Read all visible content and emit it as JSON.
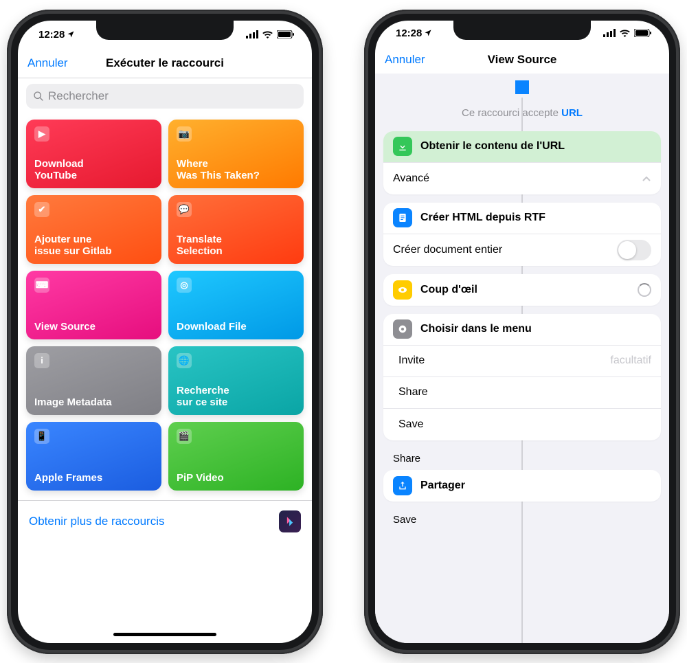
{
  "statusbar": {
    "time": "12:28"
  },
  "left": {
    "cancel": "Annuler",
    "title": "Exécuter le raccourci",
    "search_placeholder": "Rechercher",
    "tiles": [
      {
        "label": "Download\nYouTube",
        "icon": "▶",
        "gradient": "linear-gradient(160deg,#ff3b57,#e6192f)"
      },
      {
        "label": "Where\nWas This Taken?",
        "icon": "📷",
        "gradient": "linear-gradient(160deg,#ffb02e,#ff7a00)"
      },
      {
        "label": "Ajouter une\nissue sur Gitlab",
        "icon": "✔",
        "gradient": "linear-gradient(160deg,#ff7a3d,#ff4f12)"
      },
      {
        "label": "Translate\nSelection",
        "icon": "💬",
        "gradient": "linear-gradient(160deg,#ff6f3a,#ff3b10)"
      },
      {
        "label": "View Source",
        "icon": "⌨",
        "gradient": "linear-gradient(160deg,#ff3aa4,#e60e7e)"
      },
      {
        "label": "Download File",
        "icon": "◎",
        "gradient": "linear-gradient(160deg,#1fc8ff,#0099e6)"
      },
      {
        "label": "Image Metadata",
        "icon": "i",
        "gradient": "linear-gradient(160deg,#9e9ea3,#7f7f85)"
      },
      {
        "label": "Recherche\nsur ce site",
        "icon": "🌐",
        "gradient": "linear-gradient(160deg,#29c4c4,#0aa5a5)"
      },
      {
        "label": "Apple Frames",
        "icon": "📱",
        "gradient": "linear-gradient(160deg,#3a86ff,#1b5de0)"
      },
      {
        "label": "PiP Video",
        "icon": "🎬",
        "gradient": "linear-gradient(160deg,#5fcf4f,#2db224)"
      }
    ],
    "footer_label": "Obtenir plus de raccourcis"
  },
  "right": {
    "cancel": "Annuler",
    "title": "View Source",
    "accept_prefix": "Ce raccourci accepte ",
    "accept_type": "URL",
    "action1": "Obtenir le contenu de l'URL",
    "advanced": "Avancé",
    "action2": "Créer HTML depuis RTF",
    "create_doc": "Créer document entier",
    "action3": "Coup d'œil",
    "action4": "Choisir dans le menu",
    "prompt_label": "Invite",
    "prompt_placeholder": "facultatif",
    "menu_opt1": "Share",
    "menu_opt2": "Save",
    "section_share": "Share",
    "share_label": "Partager",
    "section_save": "Save"
  }
}
